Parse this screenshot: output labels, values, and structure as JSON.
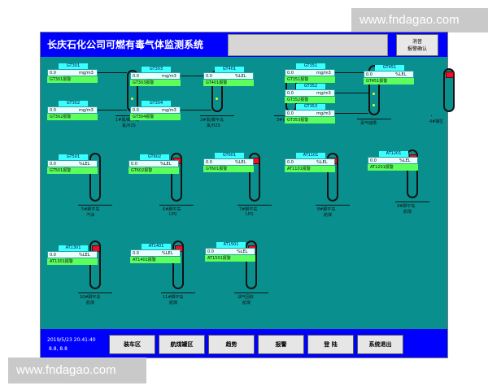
{
  "watermark": "www.fndagao.com",
  "header": {
    "title": "长庆石化公司可燃有毒气体监测系统",
    "ack_button": {
      "line1": "消音",
      "line2": "报警确认"
    }
  },
  "tanks": [
    {
      "label1": "1#氯/脚平岛",
      "label2": "氯/H2S"
    },
    {
      "label1": "2#氯/脚平岛",
      "label2": "氯/H2S"
    },
    {
      "label1": "3#氯槽站",
      "label2": ""
    },
    {
      "label1": "毒气储槽",
      "label2": ""
    },
    {
      "label1": "4#罐区",
      "label2": ""
    },
    {
      "label1": "5#脚平岛",
      "label2": "汽油"
    },
    {
      "label1": "6#脚平岛",
      "label2": "LPG"
    },
    {
      "label1": "7#脚平岛",
      "label2": "LPG"
    },
    {
      "label1": "8#脚平岛",
      "label2": "航煤"
    },
    {
      "label1": "9#脚平岛",
      "label2": "航煤"
    },
    {
      "label1": "10#脚平岛",
      "label2": "航煤"
    },
    {
      "label1": "11#脚平岛",
      "label2": "航煤"
    },
    {
      "label1": "油气回收",
      "label2": "航煤"
    }
  ],
  "detectors": [
    {
      "id": "GT301",
      "value": "0.0",
      "unit": "mg/m3",
      "name": "GT301报警"
    },
    {
      "id": "GT302",
      "value": "0.0",
      "unit": "mg/m3",
      "name": "GT302报警"
    },
    {
      "id": "GT303",
      "value": "0.0",
      "unit": "mg/m3",
      "name": "GT303报警"
    },
    {
      "id": "GT304",
      "value": "0.0",
      "unit": "mg/m3",
      "name": "GT304报警"
    },
    {
      "id": "GT401",
      "value": "0.0",
      "unit": "%LEL",
      "name": "GT401报警"
    },
    {
      "id": "GT351",
      "value": "0.0",
      "unit": "mg/m3",
      "name": "GT351报警"
    },
    {
      "id": "GT352",
      "value": "0.0",
      "unit": "mg/m3",
      "name": "GT352报警"
    },
    {
      "id": "GT353",
      "value": "0.0",
      "unit": "mg/m3",
      "name": "GT353报警"
    },
    {
      "id": "GT451",
      "value": "0.0",
      "unit": "%LEL",
      "name": "GT451报警"
    },
    {
      "id": "GT501",
      "value": "0.0",
      "unit": "%LEL",
      "name": "GT501报警"
    },
    {
      "id": "GT602",
      "value": "0.0",
      "unit": "%LEL",
      "name": "GT602报警"
    },
    {
      "id": "GT601",
      "value": "0.0",
      "unit": "%LEL",
      "name": "GT601报警"
    },
    {
      "id": "AT1101",
      "value": "0.0",
      "unit": "%LEL",
      "name": "AT1101报警"
    },
    {
      "id": "AT1201",
      "value": "0.0",
      "unit": "%LEL",
      "name": "AT1201报警"
    },
    {
      "id": "AT1301",
      "value": "0.0",
      "unit": "%LEL",
      "name": "AT1301报警"
    },
    {
      "id": "AT1401",
      "value": "0.0",
      "unit": "%LEL",
      "name": "AT1401报警"
    },
    {
      "id": "AT1501",
      "value": "0.0",
      "unit": "%LEL",
      "name": "AT1501报警"
    }
  ],
  "footer": {
    "datetime": "2019/5/23 20:41:40",
    "user": "8.8, 8.8",
    "nav": [
      "装车区",
      "航煤罐区",
      "趋势",
      "报警",
      "登  陆",
      "系统退出"
    ]
  },
  "colors": {
    "background": "#0a8f8f",
    "title_bar": "#0000ff",
    "id_tag": "#3affff",
    "name_tag": "#5cff5c",
    "alarm_lamp": "#e8102a"
  }
}
